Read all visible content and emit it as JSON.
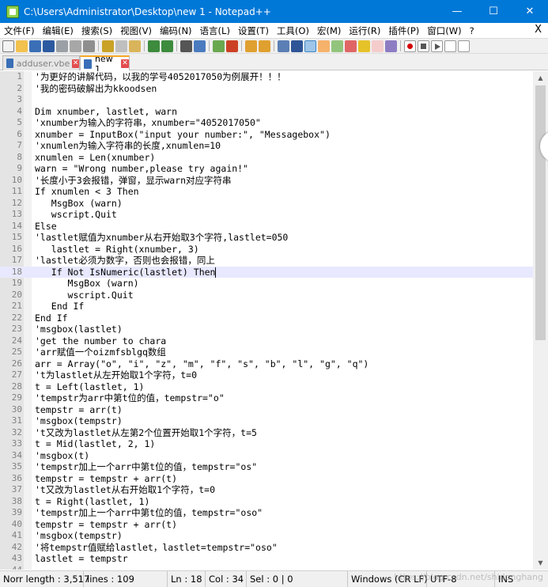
{
  "window": {
    "title": "C:\\Users\\Administrator\\Desktop\\new 1 - Notepad++",
    "minimize": "—",
    "maximize": "☐",
    "close": "✕"
  },
  "menu": {
    "items": [
      "文件(F)",
      "编辑(E)",
      "搜索(S)",
      "视图(V)",
      "编码(N)",
      "语言(L)",
      "设置(T)",
      "工具(O)",
      "宏(M)",
      "运行(R)",
      "插件(P)",
      "窗口(W)",
      "?"
    ],
    "close": "X"
  },
  "tabs": [
    {
      "label": "adduser.vbe",
      "active": false
    },
    {
      "label": "new 1",
      "active": true
    }
  ],
  "editor": {
    "current_line": 18,
    "lines": [
      "'为更好的讲解代码，以我的学号4052017050为例展开！！！",
      "'我的密码破解出为kkoodsen",
      "",
      "Dim xnumber, lastlet, warn",
      "'xnumber为输入的字符串，xnumber=\"4052017050\"",
      "xnumber = InputBox(\"input your number:\", \"Messagebox\")",
      "'xnumlen为输入字符串的长度,xnumlen=10",
      "xnumlen = Len(xnumber)",
      "warn = \"Wrong number,please try again!\"",
      "'长度小于3会报错，弹窗，显示warn对应字符串",
      "If xnumlen < 3 Then",
      "   MsgBox (warn)",
      "   wscript.Quit",
      "Else",
      "'lastlet赋值为xnumber从右开始取3个字符,lastlet=050",
      "   lastlet = Right(xnumber, 3)",
      "'lastlet必须为数字，否则也会报错，同上",
      "   If Not IsNumeric(lastlet) Then",
      "      MsgBox (warn)",
      "      wscript.Quit",
      "   End If",
      "End If",
      "'msgbox(lastlet)",
      "'get the number to chara",
      "'arr赋值一个oizmfsblgq数组",
      "arr = Array(\"o\", \"i\", \"z\", \"m\", \"f\", \"s\", \"b\", \"l\", \"g\", \"q\")",
      "'t为lastlet从左开始取1个字符，t=0",
      "t = Left(lastlet, 1)",
      "'tempstr为arr中第t位的值，tempstr=\"o\"",
      "tempstr = arr(t)",
      "'msgbox(tempstr)",
      "'t又改为lastlet从左第2个位置开始取1个字符，t=5",
      "t = Mid(lastlet, 2, 1)",
      "'msgbox(t)",
      "'tempstr加上一个arr中第t位的值，tempstr=\"os\"",
      "tempstr = tempstr + arr(t)",
      "'t又改为lastlet从右开始取1个字符，t=0",
      "t = Right(lastlet, 1)",
      "'tempstr加上一个arr中第t位的值，tempstr=\"oso\"",
      "tempstr = tempstr + arr(t)",
      "'msgbox(tempstr)",
      "'将tempstr值赋给lastlet，lastlet=tempstr=\"oso\"",
      "lastlet = tempstr",
      ""
    ]
  },
  "status": {
    "length": "Norr length : 3,517",
    "lines": "lines : 109",
    "ln": "Ln : 18",
    "col": "Col : 34",
    "sel": "Sel : 0 | 0",
    "eol": "Windows (CR LF)",
    "encoding": "UTF-8",
    "mode": "INS"
  },
  "watermark": "https://blog.csdn.net/shidonghang"
}
